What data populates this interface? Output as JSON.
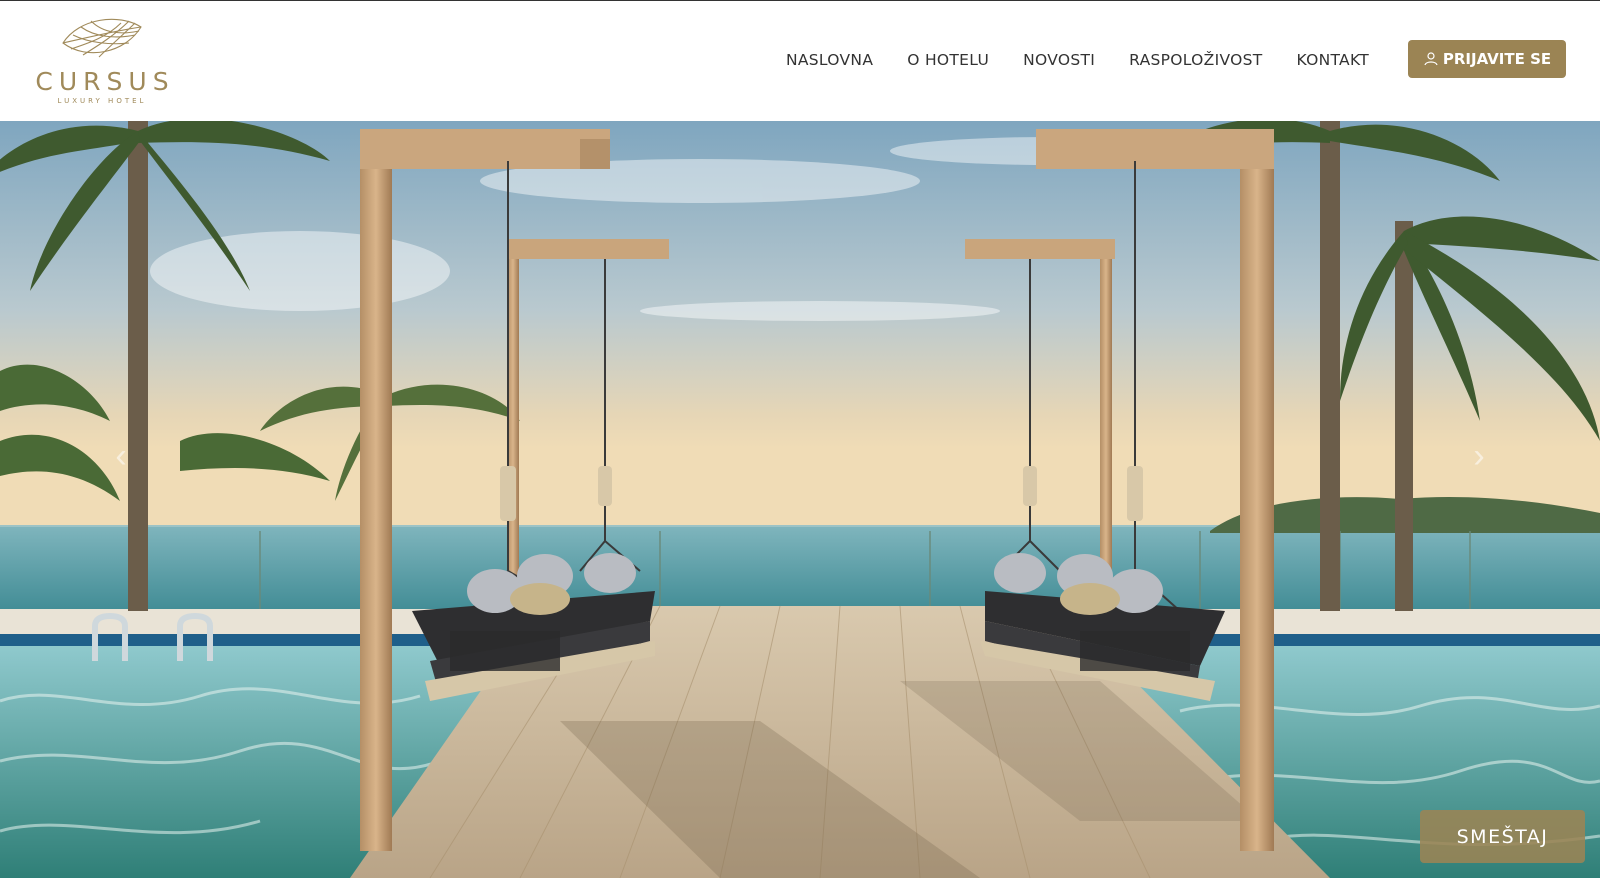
{
  "brand": {
    "name": "CURSUS",
    "tagline": "LUXURY HOTEL",
    "color": "#a08a5a"
  },
  "nav": {
    "items": [
      {
        "label": "NASLOVNA"
      },
      {
        "label": "O HOTELU"
      },
      {
        "label": "NOVOSTI"
      },
      {
        "label": "RASPOLOŽIVOST"
      },
      {
        "label": "KONTAKT"
      }
    ],
    "login_label": "PRIJAVITE SE",
    "login_icon": "user-icon",
    "accent_color": "#9b8454"
  },
  "hero": {
    "image": "pool-deck-swings-ocean",
    "prev_icon": "chevron-left-icon",
    "next_icon": "chevron-right-icon",
    "prev_symbol": "‹",
    "next_symbol": "›",
    "cta_label": "SMEŠTAJ"
  }
}
